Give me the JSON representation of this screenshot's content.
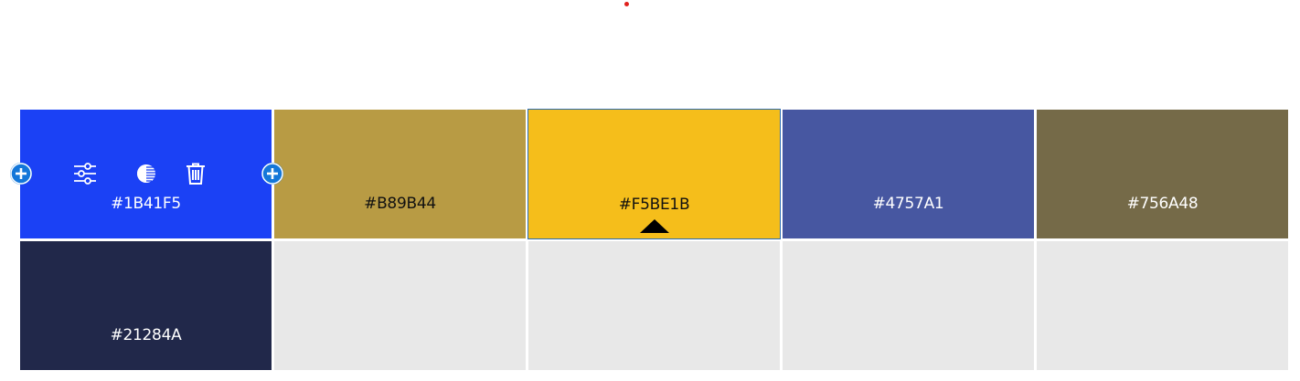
{
  "palette": {
    "swatches": [
      {
        "hex": "#1B41F5",
        "label": "#1B41F5",
        "text_color": "#ffffff"
      },
      {
        "hex": "#B89B44",
        "label": "#B89B44",
        "text_color": "#111111"
      },
      {
        "hex": "#F5BE1B",
        "label": "#F5BE1B",
        "text_color": "#111111"
      },
      {
        "hex": "#4757A1",
        "label": "#4757A1",
        "text_color": "#ffffff"
      },
      {
        "hex": "#756A48",
        "label": "#756A48",
        "text_color": "#ffffff"
      },
      {
        "hex": "#21284A",
        "label": "#21284A",
        "text_color": "#ffffff"
      }
    ],
    "empty_slot_color": "#E8E8E8",
    "selected_index": 2,
    "active_toolbar_index": 0
  },
  "toolbar": {
    "icons": [
      "sliders-icon",
      "contrast-icon",
      "trash-icon"
    ],
    "add_icon": "plus-circle-icon"
  },
  "colors": {
    "accent": "#1477D9",
    "indicator_dot": "#E0201C"
  }
}
